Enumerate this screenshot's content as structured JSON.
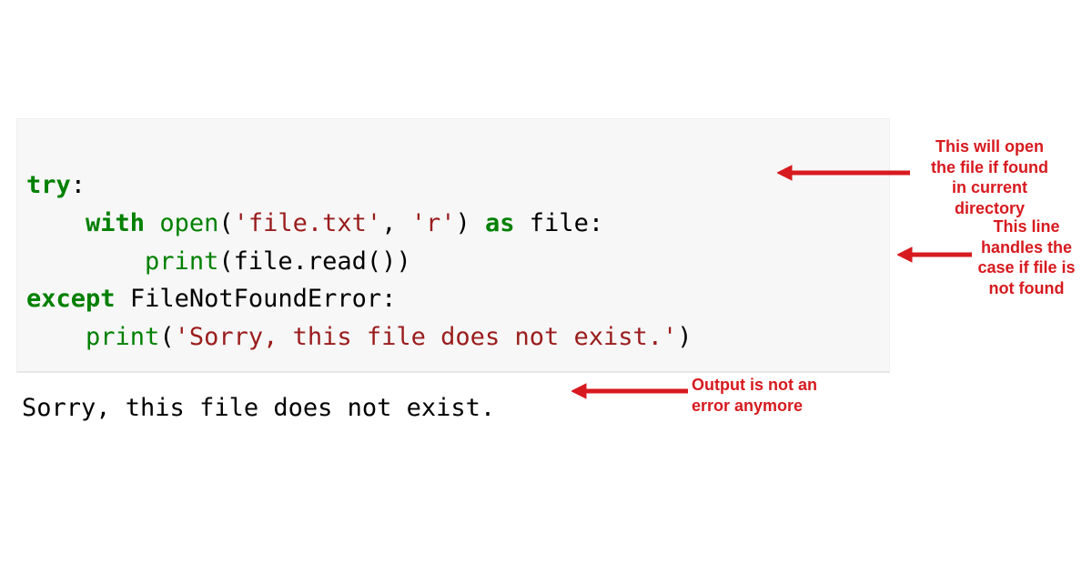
{
  "code": {
    "line1": {
      "kw": "try",
      "colon": ":"
    },
    "line2": {
      "indent": "    ",
      "kw_with": "with",
      "space1": " ",
      "fn_open": "open",
      "lp": "(",
      "str_file": "'file.txt'",
      "comma": ", ",
      "str_mode": "'r'",
      "rp": ")",
      "space2": " ",
      "kw_as": "as",
      "space3": " ",
      "id_file": "file",
      "colon": ":"
    },
    "line3": {
      "indent": "        ",
      "fn_print": "print",
      "lp": "(",
      "id_file": "file",
      "dot": ".",
      "fn_read": "read",
      "call": "()",
      "rp": ")"
    },
    "line4": {
      "kw_except": "except",
      "space": " ",
      "err": "FileNotFoundError",
      "colon": ":"
    },
    "line5": {
      "indent": "    ",
      "fn_print": "print",
      "lp": "(",
      "str_msg": "'Sorry, this file does not exist.'",
      "rp": ")"
    }
  },
  "output": "Sorry, this file does not exist.",
  "annotations": {
    "a1": "This will open\nthe file if found\nin current\ndirectory",
    "a2": "This line\nhandles the\ncase if file is\nnot found",
    "a3": "Output is not an\nerror anymore"
  },
  "colors": {
    "annotation": "#d71a1f",
    "keyword": "#008000",
    "string": "#9a1c1c",
    "code_bg": "#f7f7f7"
  }
}
